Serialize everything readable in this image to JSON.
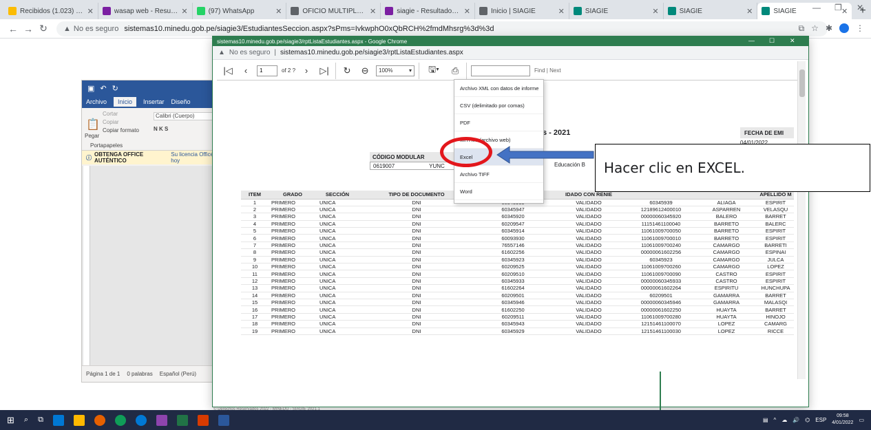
{
  "browser": {
    "tabs": [
      {
        "title": "Recibidos (1.023) - ag",
        "color": "#fbbc04"
      },
      {
        "title": "wasap web - Resultad",
        "color": "#7b1fa2"
      },
      {
        "title": "(97) WhatsApp",
        "color": "#25d366"
      },
      {
        "title": "OFICIO MÚLTIPLE 00",
        "color": "#5f6368"
      },
      {
        "title": "siagie - Resultados de",
        "color": "#7b1fa2"
      },
      {
        "title": "Inicio | SIAGIE",
        "color": "#5f6368"
      },
      {
        "title": "SIAGIE",
        "color": "#00897b"
      },
      {
        "title": "SIAGIE",
        "color": "#00897b"
      },
      {
        "title": "SIAGIE",
        "color": "#00897b"
      }
    ],
    "insecure_label": "No es seguro",
    "url": "sistemas10.minedu.gob.pe/siagie3/EstudiantesSeccion.aspx?sPms=IvkwphO0xQbRCH%2fmdMhsrg%3d%3d"
  },
  "word": {
    "tabs": [
      "Archivo",
      "Inicio",
      "Insertar",
      "Diseño"
    ],
    "cut": "Cortar",
    "copy": "Copiar",
    "paste": "Pegar",
    "format_painter": "Copiar formato",
    "clipboard_group": "Portapapeles",
    "font": "Calibri (Cuerpo)",
    "notice": "OBTENGA OFFICE AUTÉNTICO",
    "notice_detail": "Su licencia Office hoy",
    "status_page": "Página 1 de 1",
    "status_words": "0 palabras",
    "status_lang": "Español (Perú)"
  },
  "popup": {
    "title": "sistemas10.minedu.gob.pe/siagie3/rptListaEstudiantes.aspx - Google Chrome",
    "insecure_label": "No es seguro",
    "url": "sistemas10.minedu.gob.pe/siagie3/rptListaEstudiantes.aspx"
  },
  "viewer": {
    "page_input": "1",
    "page_of": "of 2 ?",
    "zoom": "100%",
    "find_link": "Find | Next"
  },
  "report": {
    "heading": "s - 2021",
    "fecha_label": "FECHA DE EMI",
    "fecha": "04/01/2022",
    "codigo_modular_label": "CÓDIGO MODULAR",
    "codigo_modular": "0619007",
    "nombre": "YUNC",
    "nivel": "Educación B",
    "columns": [
      "ITEM",
      "GRADO",
      "SECCIÓN",
      "TIPO DE DOCUMENTO",
      "N",
      "IDADO CON RENIE",
      "",
      "",
      "APELLIDO M"
    ],
    "rows": [
      [
        "1",
        "PRIMERO",
        "UNICA",
        "DNI",
        "60345939",
        "VALIDADO",
        "60345939",
        "ALIAGA",
        "ESPIRIT"
      ],
      [
        "2",
        "PRIMERO",
        "UNICA",
        "DNI",
        "60345947",
        "VALIDADO",
        "12189612400010",
        "ASPARREN",
        "VELASQU"
      ],
      [
        "3",
        "PRIMERO",
        "UNICA",
        "DNI",
        "60345920",
        "VALIDADO",
        "00000060345920",
        "BALERO",
        "BARRET"
      ],
      [
        "4",
        "PRIMERO",
        "UNICA",
        "DNI",
        "60209547",
        "VALIDADO",
        "11151461100040",
        "BARRETO",
        "BALERC"
      ],
      [
        "5",
        "PRIMERO",
        "UNICA",
        "DNI",
        "60345914",
        "VALIDADO",
        "11061009700050",
        "BARRETO",
        "ESPIRIT"
      ],
      [
        "6",
        "PRIMERO",
        "UNICA",
        "DNI",
        "60093930",
        "VALIDADO",
        "11061009700010",
        "BARRETO",
        "ESPIRIT"
      ],
      [
        "7",
        "PRIMERO",
        "UNICA",
        "DNI",
        "76557146",
        "VALIDADO",
        "11061009700240",
        "CAMARGO",
        "BARRETI"
      ],
      [
        "8",
        "PRIMERO",
        "UNICA",
        "DNI",
        "61602256",
        "VALIDADO",
        "00000061602256",
        "CAMARGO",
        "ESPINAI"
      ],
      [
        "9",
        "PRIMERO",
        "UNICA",
        "DNI",
        "60345923",
        "VALIDADO",
        "60345923",
        "CAMARGO",
        "JULCA"
      ],
      [
        "10",
        "PRIMERO",
        "UNICA",
        "DNI",
        "60209525",
        "VALIDADO",
        "11061009700260",
        "CAMARGO",
        "LOPEZ"
      ],
      [
        "11",
        "PRIMERO",
        "UNICA",
        "DNI",
        "60209510",
        "VALIDADO",
        "11061009700090",
        "CASTRO",
        "ESPIRIT"
      ],
      [
        "12",
        "PRIMERO",
        "UNICA",
        "DNI",
        "60345933",
        "VALIDADO",
        "00000060345933",
        "CASTRO",
        "ESPIRIT"
      ],
      [
        "13",
        "PRIMERO",
        "UNICA",
        "DNI",
        "61602264",
        "VALIDADO",
        "00000061602264",
        "ESPIRITU",
        "HUNCHUPA"
      ],
      [
        "14",
        "PRIMERO",
        "UNICA",
        "DNI",
        "60209501",
        "VALIDADO",
        "60209501",
        "GAMARRA",
        "BARRET"
      ],
      [
        "15",
        "PRIMERO",
        "UNICA",
        "DNI",
        "60345946",
        "VALIDADO",
        "00000060345946",
        "GAMARRA",
        "MALASQI"
      ],
      [
        "16",
        "PRIMERO",
        "UNICA",
        "DNI",
        "61602250",
        "VALIDADO",
        "00000061602250",
        "HUAYTA",
        "BARRET"
      ],
      [
        "17",
        "PRIMERO",
        "UNICA",
        "DNI",
        "60209511",
        "VALIDADO",
        "11061009700280",
        "HUAYTA",
        "HINOJO"
      ],
      [
        "18",
        "PRIMERO",
        "UNICA",
        "DNI",
        "60345943",
        "VALIDADO",
        "12151461100070",
        "LOPEZ",
        "CAMARG"
      ],
      [
        "19",
        "PRIMERO",
        "UNICA",
        "DNI",
        "60345929",
        "VALIDADO",
        "12151461100030",
        "LOPEZ",
        "RICCE"
      ]
    ]
  },
  "export_menu": {
    "items": [
      "Archivo XML con datos de informe",
      "CSV (delimitado por comas)",
      "PDF",
      "MHTML (archivo web)",
      "Excel",
      "Archivo TIFF",
      "Word"
    ]
  },
  "annotation": {
    "text": "Hacer clic en EXCEL.",
    "arrow_color": "#4472c4",
    "circle_color": "#e3171c"
  },
  "footer": "© Derechos Reservados 2022 - MINEDU - SIAGIE 2021.1",
  "taskbar": {
    "time": "09:58",
    "date": "4/01/2022",
    "lang": "ESP"
  }
}
